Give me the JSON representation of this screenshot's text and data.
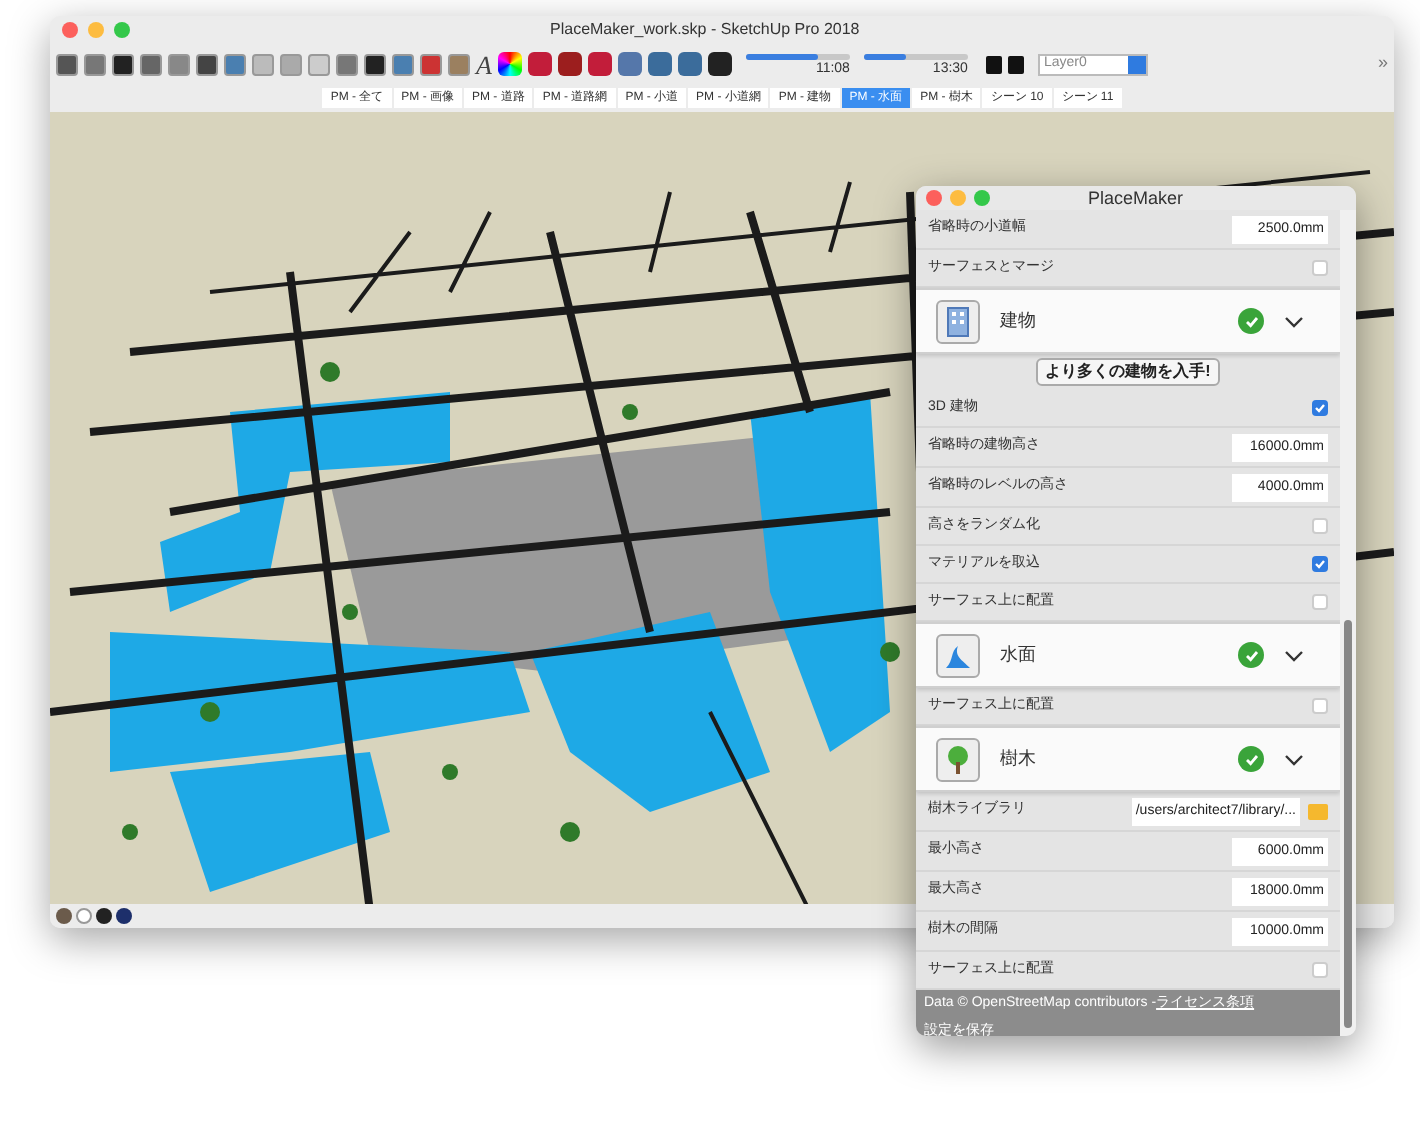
{
  "window": {
    "title": "PlaceMaker_work.skp - SketchUp Pro 2018"
  },
  "toolbar": {
    "text_tool": "A",
    "sliders": [
      {
        "reading": "11:08",
        "level": 0.7
      },
      {
        "reading": "13:30",
        "level": 0.4
      }
    ],
    "layer": "Layer0",
    "overflow": "»"
  },
  "scene_tabs": [
    {
      "label": "PM - 全て",
      "selected": false
    },
    {
      "label": "PM - 画像",
      "selected": false
    },
    {
      "label": "PM - 道路",
      "selected": false
    },
    {
      "label": "PM - 道路網",
      "selected": false
    },
    {
      "label": "PM - 小道",
      "selected": false
    },
    {
      "label": "PM - 小道網",
      "selected": false
    },
    {
      "label": "PM - 建物",
      "selected": false
    },
    {
      "label": "PM - 水面",
      "selected": true
    },
    {
      "label": "PM - 樹木",
      "selected": false
    },
    {
      "label": "シーン 10",
      "selected": false
    },
    {
      "label": "シーン 11",
      "selected": false
    }
  ],
  "placemaker": {
    "title": "PlaceMaker",
    "rows": [
      {
        "kind": "value",
        "label": "省略時の小道幅",
        "value": "2500.0mm"
      },
      {
        "kind": "check",
        "label": "サーフェスとマージ",
        "checked": false
      },
      {
        "kind": "section",
        "label": "建物",
        "enabled": true,
        "expanded": true
      },
      {
        "kind": "button",
        "label": "より多くの建物を入手!"
      },
      {
        "kind": "check",
        "label": "3D 建物",
        "checked": true
      },
      {
        "kind": "value",
        "label": "省略時の建物高さ",
        "value": "16000.0mm"
      },
      {
        "kind": "value",
        "label": "省略時のレベルの高さ",
        "value": "4000.0mm"
      },
      {
        "kind": "check",
        "label": "高さをランダム化",
        "checked": false
      },
      {
        "kind": "check",
        "label": "マテリアルを取込",
        "checked": true
      },
      {
        "kind": "check",
        "label": "サーフェス上に配置",
        "checked": false
      },
      {
        "kind": "section",
        "label": "水面",
        "enabled": true,
        "expanded": true
      },
      {
        "kind": "check",
        "label": "サーフェス上に配置",
        "checked": false
      },
      {
        "kind": "section",
        "label": "樹木",
        "enabled": true,
        "expanded": true
      },
      {
        "kind": "path",
        "label": "樹木ライブラリ",
        "value": "/users/architect7/library/..."
      },
      {
        "kind": "value",
        "label": "最小高さ",
        "value": "6000.0mm"
      },
      {
        "kind": "value",
        "label": "最大高さ",
        "value": "18000.0mm"
      },
      {
        "kind": "value",
        "label": "樹木の間隔",
        "value": "10000.0mm"
      },
      {
        "kind": "check",
        "label": "サーフェス上に配置",
        "checked": false
      }
    ],
    "footer": {
      "credit": "Data © OpenStreetMap contributors - ",
      "license_link": "ライセンス条項",
      "save": "設定を保存"
    }
  }
}
